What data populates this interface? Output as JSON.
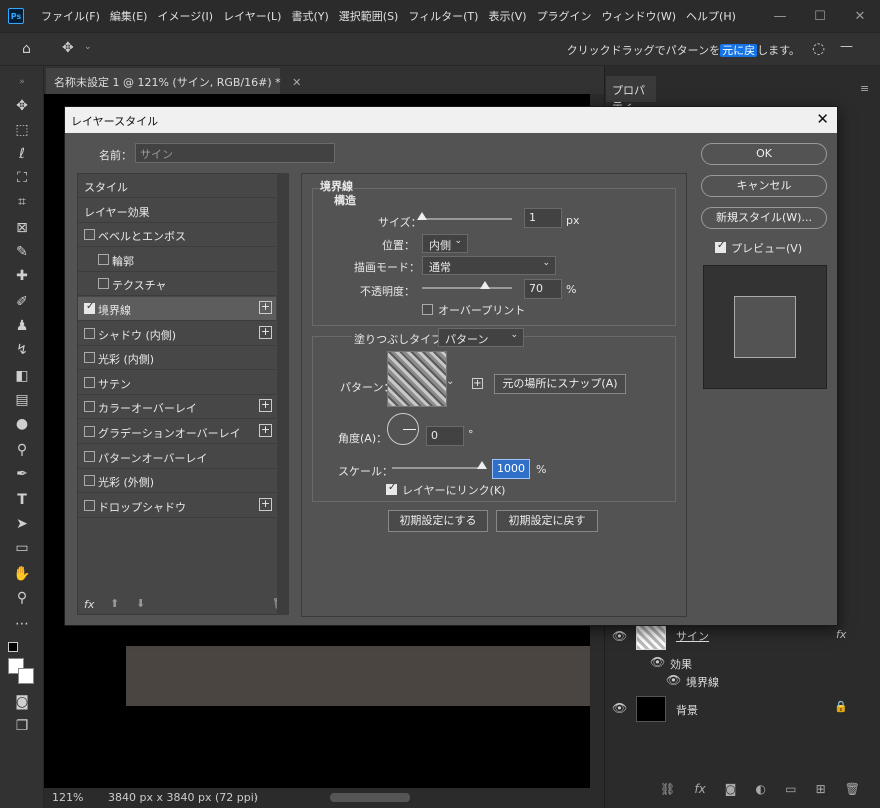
{
  "app": {
    "logo": "Ps",
    "menu": [
      "ファイル(F)",
      "編集(E)",
      "イメージ(I)",
      "レイヤー(L)",
      "書式(Y)",
      "選択範囲(S)",
      "フィルター(T)",
      "表示(V)",
      "プラグイン",
      "ウィンドウ(W)",
      "ヘルプ(H)"
    ]
  },
  "options_bar": {
    "hint_before": "クリックドラッグでパターンを",
    "hint_highlight": "元に戻",
    "hint_after": "します。"
  },
  "document": {
    "tab_title": "名称未設定 1 @ 121% (サイン, RGB/16#) *",
    "zoom": "121%",
    "dimensions": "3840 px x 3840 px (72 ppi)"
  },
  "panels": {
    "properties_tab": "プロパティ",
    "layers": [
      {
        "name": "サイン",
        "fx": "fx"
      },
      {
        "name": "効果"
      },
      {
        "name": "境界線"
      },
      {
        "name": "背景"
      }
    ]
  },
  "dialog": {
    "title": "レイヤースタイル",
    "name_label": "名前：",
    "name_placeholder": "サイン",
    "style_items": [
      {
        "label": "スタイル",
        "checkbox": false,
        "checked": false,
        "plus": false
      },
      {
        "label": "レイヤー効果",
        "checkbox": false,
        "checked": false,
        "plus": false
      },
      {
        "label": "ベベルとエンボス",
        "checkbox": true,
        "checked": false,
        "plus": false
      },
      {
        "label": "輪郭",
        "checkbox": true,
        "checked": false,
        "plus": false
      },
      {
        "label": "テクスチャ",
        "checkbox": true,
        "checked": false,
        "plus": false
      },
      {
        "label": "境界線",
        "checkbox": true,
        "checked": true,
        "plus": true
      },
      {
        "label": "シャドウ (内側)",
        "checkbox": true,
        "checked": false,
        "plus": true
      },
      {
        "label": "光彩 (内側)",
        "checkbox": true,
        "checked": false,
        "plus": false
      },
      {
        "label": "サテン",
        "checkbox": true,
        "checked": false,
        "plus": false
      },
      {
        "label": "カラーオーバーレイ",
        "checkbox": true,
        "checked": false,
        "plus": true
      },
      {
        "label": "グラデーションオーバーレイ",
        "checkbox": true,
        "checked": false,
        "plus": true
      },
      {
        "label": "パターンオーバーレイ",
        "checkbox": true,
        "checked": false,
        "plus": false
      },
      {
        "label": "光彩 (外側)",
        "checkbox": true,
        "checked": false,
        "plus": false
      },
      {
        "label": "ドロップシャドウ",
        "checkbox": true,
        "checked": false,
        "plus": true
      }
    ],
    "fx_label": "fx",
    "stroke": {
      "section_title": "境界線",
      "structure_title": "構造",
      "size_label": "サイズ：",
      "size_value": "1",
      "size_unit": "px",
      "size_fraction": 0.0,
      "position_label": "位置：",
      "position_value": "内側",
      "blend_label": "描画モード：",
      "blend_value": "通常",
      "opacity_label": "不透明度：",
      "opacity_value": "70",
      "opacity_unit": "%",
      "opacity_fraction": 0.7,
      "overprint_label": "オーバープリント",
      "fill_type_label": "塗りつぶしタイプ：",
      "fill_type_value": "パターン",
      "pattern_label": "パターン：",
      "snap_button": "元の場所にスナップ(A)",
      "angle_label": "角度(A)：",
      "angle_value": "0",
      "angle_unit": "°",
      "scale_label": "スケール：",
      "scale_value": "1000",
      "scale_unit": "%",
      "scale_fraction": 1.0,
      "link_label": "レイヤーにリンク(K)",
      "link_checked": true,
      "make_default": "初期設定にする",
      "reset_default": "初期設定に戻す"
    },
    "buttons": {
      "ok": "OK",
      "cancel": "キャンセル",
      "new_style": "新規スタイル(W)...",
      "preview_label": "プレビュー(V)",
      "preview_checked": true
    }
  }
}
